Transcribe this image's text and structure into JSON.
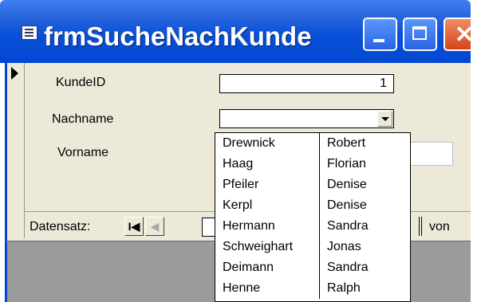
{
  "window": {
    "title": "frmSucheNachKunde",
    "controls": {
      "minimize": "minimize",
      "maximize": "maximize",
      "close": "close"
    }
  },
  "form": {
    "kundeid_label": "KundeID",
    "kundeid_value": "1",
    "nachname_label": "Nachname",
    "nachname_value": "",
    "vorname_label": "Vorname",
    "vorname_value": ""
  },
  "dropdown": {
    "rows": [
      {
        "nachname": "Drewnick",
        "vorname": "Robert"
      },
      {
        "nachname": "Haag",
        "vorname": "Florian"
      },
      {
        "nachname": "Pfeiler",
        "vorname": "Denise"
      },
      {
        "nachname": "Kerpl",
        "vorname": "Denise"
      },
      {
        "nachname": "Hermann",
        "vorname": "Sandra"
      },
      {
        "nachname": "Schweighart",
        "vorname": "Jonas"
      },
      {
        "nachname": "Deimann",
        "vorname": "Sandra"
      },
      {
        "nachname": "Henne",
        "vorname": "Ralph"
      }
    ]
  },
  "navigation": {
    "label": "Datensatz:",
    "first_glyph": "I◀",
    "prev_glyph": "◀",
    "of_label": "von"
  },
  "colors": {
    "titlebar": "#0047d2",
    "form_background": "#ece9d8",
    "close_button": "#d6451c"
  }
}
